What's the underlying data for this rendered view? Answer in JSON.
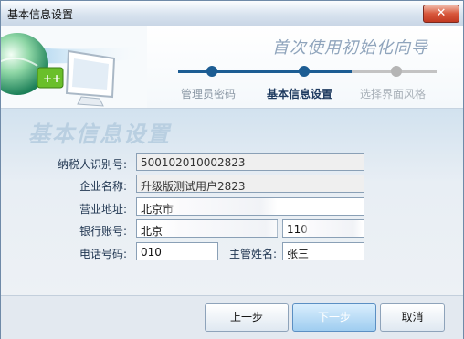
{
  "window": {
    "title": "基本信息设置",
    "close_glyph": "✕"
  },
  "banner": {
    "wizard_title": "首次使用初始化向导",
    "steps": [
      {
        "label": "管理员密码",
        "state": "done"
      },
      {
        "label": "基本信息设置",
        "state": "current"
      },
      {
        "label": "选择界面风格",
        "state": "pending"
      }
    ]
  },
  "form": {
    "section_title": "基本信息设置",
    "tax_id": {
      "label": "纳税人识别号:",
      "value": "500102010002823"
    },
    "company": {
      "label": "企业名称:",
      "value": "升级版测试用户2823"
    },
    "address": {
      "label": "营业地址:",
      "value": "北京市"
    },
    "bank": {
      "label": "银行账号:",
      "value": "北京",
      "account": "110"
    },
    "phone": {
      "label": "电话号码:",
      "value": "010"
    },
    "manager": {
      "label": "主管姓名:",
      "value": "张三"
    }
  },
  "buttons": {
    "prev": "上一步",
    "next": "下一步",
    "cancel": "取消"
  },
  "colors": {
    "done": "#1c5d93",
    "pending": "#b5b5b5",
    "label_done": "#8c99a6",
    "label_current": "#1e3a5f",
    "label_pending": "#a8b0b8"
  }
}
